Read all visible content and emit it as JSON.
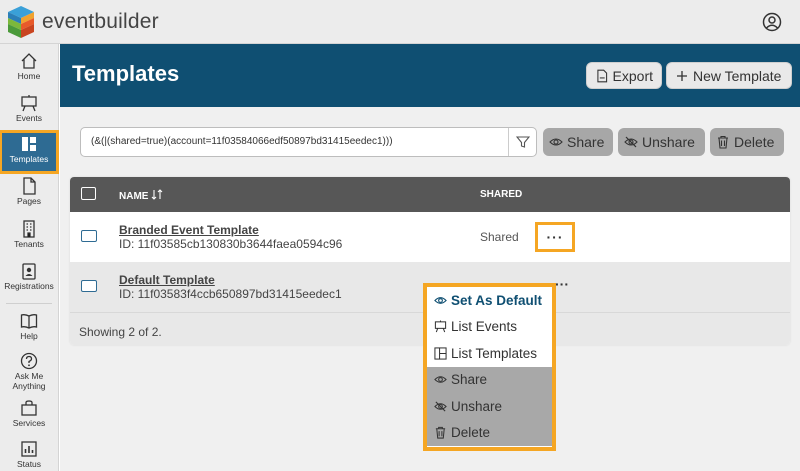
{
  "app": {
    "brand": "eventbuilder"
  },
  "sidebar": {
    "items": [
      {
        "label": "Home",
        "icon": "home-icon"
      },
      {
        "label": "Events",
        "icon": "easel-icon"
      },
      {
        "label": "Templates",
        "icon": "templates-icon",
        "active": true
      },
      {
        "label": "Pages",
        "icon": "page-icon"
      },
      {
        "label": "Tenants",
        "icon": "building-icon"
      },
      {
        "label": "Registrations",
        "icon": "badge-icon"
      },
      {
        "label": "Help",
        "icon": "book-icon"
      },
      {
        "label": "Ask Me",
        "label2": "Anything",
        "icon": "question-icon"
      },
      {
        "label": "Services",
        "icon": "bag-icon"
      },
      {
        "label": "Status",
        "icon": "bar-chart-icon"
      }
    ]
  },
  "header": {
    "title": "Templates",
    "export_label": "Export",
    "new_template_label": "New Template"
  },
  "filter": {
    "query": "(&(|(shared=true)(account=11f03584066edf50897bd31415eedec1)))"
  },
  "actions": {
    "share_label": "Share",
    "unshare_label": "Unshare",
    "delete_label": "Delete"
  },
  "table": {
    "columns": {
      "name": "NAME",
      "shared": "SHARED"
    },
    "rows": [
      {
        "name": "Branded Event Template",
        "id": "ID: 11f03585cb130830b3644faea0594c96",
        "shared": "Shared"
      },
      {
        "name": "Default Template",
        "id": "ID: 11f03583f4ccb650897bd31415eedec1",
        "shared": ""
      }
    ],
    "more_label": "···",
    "showing": "Showing 2 of 2."
  },
  "menu": {
    "items": [
      {
        "label": "Set As Default",
        "icon": "eye-icon"
      },
      {
        "label": "List Events",
        "icon": "easel-icon"
      },
      {
        "label": "List Templates",
        "icon": "templates-icon"
      },
      {
        "label": "Share",
        "icon": "eye-icon"
      },
      {
        "label": "Unshare",
        "icon": "eye-slash-icon"
      },
      {
        "label": "Delete",
        "icon": "trash-icon"
      }
    ]
  },
  "colors": {
    "header_bg": "#0f4f72",
    "highlight": "#f5a623",
    "sidebar_active": "#2e6b93",
    "table_header": "#575757"
  }
}
